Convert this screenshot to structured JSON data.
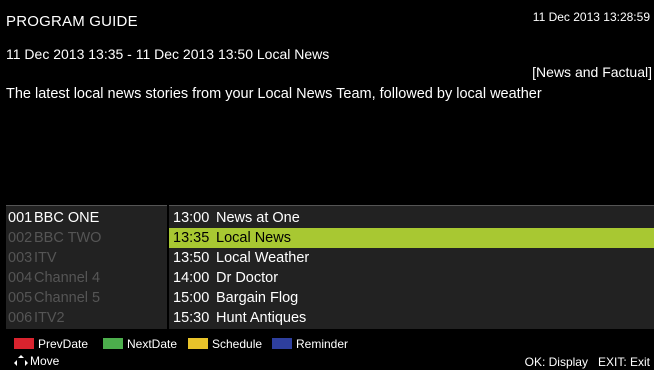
{
  "header": {
    "title": "PROGRAM GUIDE",
    "clock": "11 Dec 2013 13:28:59"
  },
  "program_info": {
    "schedule_line": "11 Dec 2013 13:35 - 11 Dec 2013 13:50 Local News",
    "genre": "[News and Factual]",
    "description": "The latest local news stories from your Local News Team, followed by local weather"
  },
  "channels": [
    {
      "num": "001",
      "name": "BBC ONE",
      "active": true
    },
    {
      "num": "002",
      "name": "BBC TWO",
      "active": false
    },
    {
      "num": "003",
      "name": "ITV",
      "active": false
    },
    {
      "num": "004",
      "name": "Channel 4",
      "active": false
    },
    {
      "num": "005",
      "name": "Channel 5",
      "active": false
    },
    {
      "num": "006",
      "name": "ITV2",
      "active": false
    }
  ],
  "programs": [
    {
      "time": "13:00",
      "name": "News at One",
      "selected": false
    },
    {
      "time": "13:35",
      "name": "Local News",
      "selected": true
    },
    {
      "time": "13:50",
      "name": "Local Weather",
      "selected": false
    },
    {
      "time": "14:00",
      "name": "Dr Doctor",
      "selected": false
    },
    {
      "time": "15:00",
      "name": "Bargain Flog",
      "selected": false
    },
    {
      "time": "15:30",
      "name": "Hunt Antiques",
      "selected": false
    }
  ],
  "legend": [
    {
      "label": "PrevDate",
      "color": "#d9232e"
    },
    {
      "label": "NextDate",
      "color": "#4cae4c"
    },
    {
      "label": "Schedule",
      "color": "#e8c32a"
    },
    {
      "label": "Reminder",
      "color": "#2e3f9e"
    }
  ],
  "footer": {
    "move_label": "Move",
    "move_icon": "arrow-keys-icon",
    "ok_label": "OK: Display",
    "exit_label": "EXIT: Exit"
  },
  "colors": {
    "highlight": "#a8c832",
    "panel_bg": "#222222",
    "inactive_text": "#555555"
  }
}
